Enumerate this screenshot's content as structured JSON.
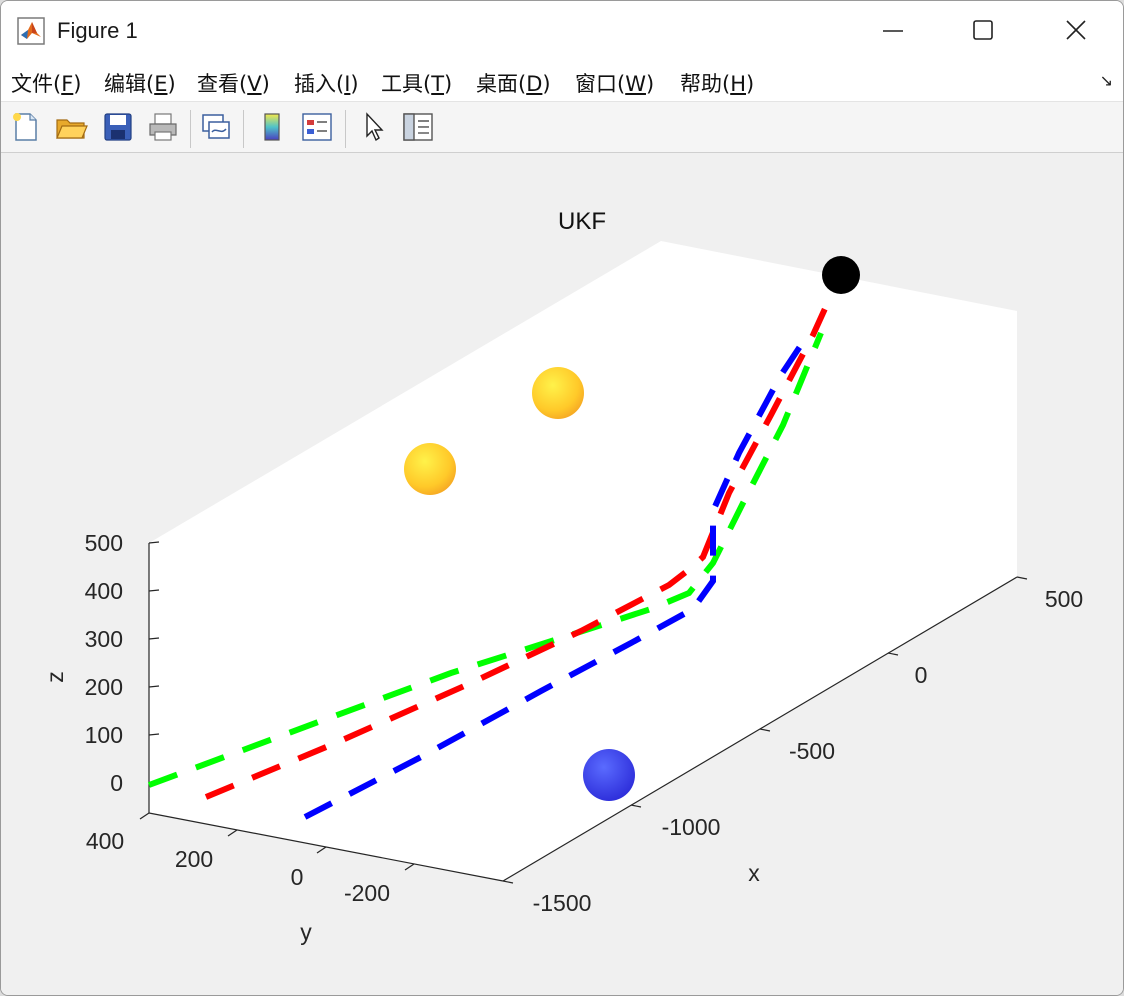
{
  "window": {
    "title": "Figure 1",
    "controls": [
      "minimize",
      "maximize",
      "close"
    ]
  },
  "menu": [
    {
      "text": "文件(",
      "key": "F",
      "end": ")"
    },
    {
      "text": "编辑(",
      "key": "E",
      "end": ")"
    },
    {
      "text": "查看(",
      "key": "V",
      "end": ")"
    },
    {
      "text": "插入(",
      "key": "I",
      "end": ")"
    },
    {
      "text": "工具(",
      "key": "T",
      "end": ")"
    },
    {
      "text": "桌面(",
      "key": "D",
      "end": ")"
    },
    {
      "text": "窗口(",
      "key": "W",
      "end": ")"
    },
    {
      "text": "帮助(",
      "key": "H",
      "end": ")"
    }
  ],
  "toolbar": {
    "buttons": [
      "new-figure-icon",
      "open-folder-icon",
      "save-icon",
      "print-icon",
      "link-plot-icon",
      "colorbar-icon",
      "legend-icon",
      "edit-plot-arrow-icon",
      "property-inspector-icon"
    ]
  },
  "colors": {
    "red_path": "#ff0000",
    "green_path": "#00ff00",
    "blue_path": "#0000ff",
    "start_marker": "#000000",
    "yellow_spheres": "#ffd21e",
    "blue_sphere": "#3b3bff"
  },
  "chart_data": {
    "type": "line3d",
    "title": "UKF",
    "xlabel": "x",
    "ylabel": "y",
    "zlabel": "z",
    "x_ticks": [
      "500",
      "0",
      "-500",
      "-1000",
      "-1500"
    ],
    "y_ticks": [
      "400",
      "200",
      "0",
      "-200"
    ],
    "z_ticks": [
      "500",
      "400",
      "300",
      "200",
      "100",
      "0"
    ],
    "xlim": [
      -1500,
      500
    ],
    "ylim": [
      -400,
      400
    ],
    "zlim": [
      0,
      500
    ],
    "series": [
      {
        "color": "red",
        "style": "dashed"
      },
      {
        "color": "green",
        "style": "dashed"
      },
      {
        "color": "blue",
        "style": "dashed"
      }
    ],
    "markers": [
      {
        "kind": "start",
        "color": "black"
      },
      {
        "kind": "sphere",
        "color": "yellow"
      },
      {
        "kind": "sphere",
        "color": "yellow"
      },
      {
        "kind": "sphere",
        "color": "blue"
      }
    ]
  }
}
